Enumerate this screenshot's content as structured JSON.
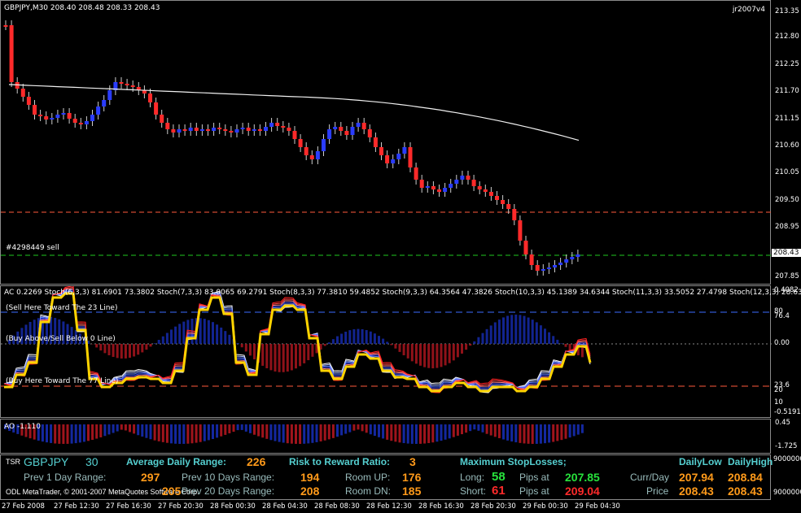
{
  "main": {
    "header": "GBPJPY,M30  208.40 208.48 208.33 208.43",
    "version": "jr2007v4",
    "order_label": "#4298449 sell",
    "price_axis": [
      "213.35",
      "212.80",
      "212.25",
      "211.70",
      "211.15",
      "210.60",
      "210.05",
      "209.50",
      "208.95",
      "208.43",
      "207.85"
    ],
    "current_price": "208.43"
  },
  "stoch": {
    "header": "AC 0.2269  Stoch(6,3,3) 81.6901 73.3802  Stoch(7,3,3) 83.0065 69.2791  Stoch(8,3,3) 77.3810 59.4852  Stoch(9,3,3) 64.3564 47.3826  Stoch(10,3,3) 45.1389 34.6344  Stoch(11,3,3) 33.5052 27.4798  Stoch(12,3,3) 28.6344 24.4",
    "texts": [
      "(Sell Here Toward The 23 Line)",
      "(Buy Above/Sell Below 0 Line)",
      "(Buy Here Toward The 77 Line)"
    ],
    "axis": [
      "0.4082",
      "80",
      "76.4",
      "0.00",
      "23.6",
      "20",
      "10",
      "-0.5191",
      "0"
    ]
  },
  "ao": {
    "header": "AO -1.110",
    "axis": [
      "0.45",
      "-1.725"
    ]
  },
  "panel": {
    "tsr": "TSR",
    "symbol": "GBPJPY",
    "timeframe": "30",
    "adr_label": "Average Daily Range:",
    "adr_value": "226",
    "rr_label": "Risk to Reward Ratio:",
    "rr_value": "3",
    "msl_label": "Maximum StopLosses;",
    "daily_low_label": "DailyLow",
    "daily_high_label": "DailyHigh",
    "prev1_label": "Prev 1 Day Range:",
    "prev1_value": "297",
    "prev10_label": "Prev 10 Days Range:",
    "prev10_value": "194",
    "room_up_label": "Room UP:",
    "room_up_value": "176",
    "long_label": "Long:",
    "long_value": "58",
    "pips_at_label": "Pips at",
    "long_price": "207.85",
    "currday_label": "Curr/Day",
    "currday_low": "207.94",
    "currday_high": "208.84",
    "copyright": "ODL MetaTrader, © 2001-2007 MetaQuotes Software Corp.",
    "prev5_value": "205",
    "prev20_label": "Prev 20 Days Range:",
    "prev20_value": "208",
    "room_dn_label": "Room DN:",
    "room_dn_value": "185",
    "short_label": "Short:",
    "short_value": "61",
    "short_price": "209.04",
    "price_label": "Price",
    "price_low": "208.43",
    "price_high": "208.43",
    "axis_top": "9000000",
    "axis_bottom": "9000000"
  },
  "time_axis": [
    "27 Feb 2008",
    "27 Feb 12:30",
    "27 Feb 16:30",
    "27 Feb 20:30",
    "28 Feb 00:30",
    "28 Feb 04:30",
    "28 Feb 08:30",
    "28 Feb 12:30",
    "28 Feb 16:30",
    "28 Feb 20:30",
    "29 Feb 00:30",
    "29 Feb 04:30"
  ],
  "colors": {
    "bull": "#2a3cff",
    "bear": "#ff2a2a",
    "ma": "#f0f0f0",
    "yellow": "#ffd400",
    "dash_red": "#ff5a3c",
    "dash_green": "#1fc81f",
    "dash_blue": "#3d6cff"
  }
}
